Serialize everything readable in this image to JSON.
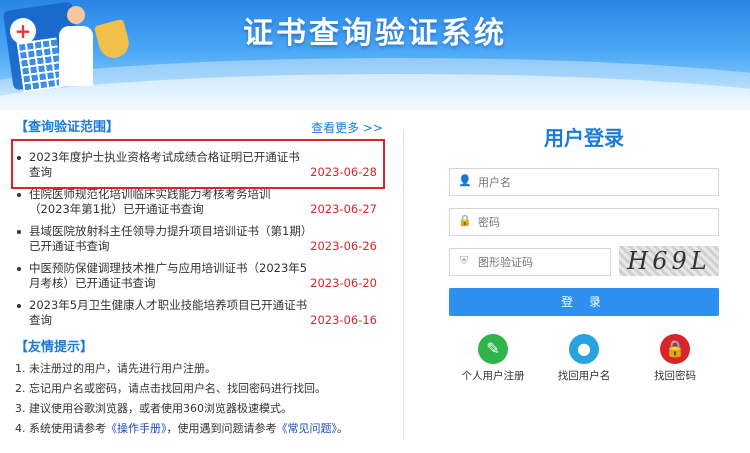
{
  "header": {
    "title": "证书查询验证系统"
  },
  "query_scope": {
    "heading": "【查询验证范围】",
    "more": "查看更多 >>",
    "items": [
      {
        "text": "2023年度护士执业资格考试成绩合格证明已开通证书查询",
        "date": "2023-06-28"
      },
      {
        "text": "住院医师规范化培训临床实践能力考核考务培训（2023年第1批）已开通证书查询",
        "date": "2023-06-27"
      },
      {
        "text": "县域医院放射科主任领导力提升项目培训证书（第1期）已开通证书查询",
        "date": "2023-06-26"
      },
      {
        "text": "中医预防保健调理技术推广与应用培训证书（2023年5月考核）已开通证书查询",
        "date": "2023-06-20"
      },
      {
        "text": "2023年5月卫生健康人才职业技能培养项目已开通证书查询",
        "date": "2023-06-16"
      }
    ]
  },
  "tips": {
    "heading": "【友情提示】",
    "items": [
      "1. 未注册过的用户，请先进行用户注册。",
      "2. 忘记用户名或密码，请点击找回用户名、找回密码进行找回。",
      "3. 建议使用谷歌浏览器，或者使用360浏览器极速模式。"
    ],
    "item4": {
      "prefix": "4. 系统使用请参考",
      "manual": "《操作手册》",
      "middle": "，使用遇到问题请参考",
      "faq": "《常见问题》",
      "suffix": "。"
    }
  },
  "login": {
    "title": "用户登录",
    "username_placeholder": "用户名",
    "password_placeholder": "密码",
    "captcha_placeholder": "图形验证码",
    "captcha_text": "H69L",
    "submit": "登 录",
    "actions": [
      {
        "label": "个人用户注册",
        "icon": "pencil-icon",
        "color": "#2fb34a"
      },
      {
        "label": "找回用户名",
        "icon": "user-icon",
        "color": "#29a3e0"
      },
      {
        "label": "找回密码",
        "icon": "lock-icon",
        "color": "#d8252b"
      }
    ]
  }
}
